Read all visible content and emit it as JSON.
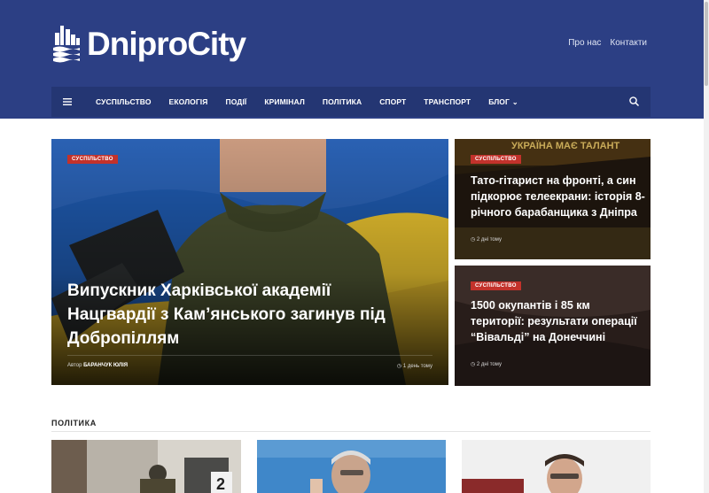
{
  "site": {
    "logo_text": "DniproCity",
    "top_links": [
      "Про нас",
      "Контакти"
    ]
  },
  "nav": {
    "items": [
      "СУСПІЛЬСТВО",
      "ЕКОЛОГІЯ",
      "ПОДІЇ",
      "КРИМІНАЛ",
      "ПОЛІТИКА",
      "СПОРТ",
      "ТРАНСПОРТ",
      "БЛОГ"
    ]
  },
  "hero": {
    "category": "СУСПІЛЬСТВО",
    "title": "Випускник Харківської академії Нацгвардії з Кам’янського загинув під Добропіллям",
    "author_label": "Автор",
    "author": "БАРАНЧУК ЮЛІЯ",
    "time": "1 день тому"
  },
  "side_articles": [
    {
      "category": "СУСПІЛЬСТВО",
      "title": "Тато-гітарист на фронті, а син підкорює телеекрани: історія 8-річного барабанщика з Дніпра",
      "time": "2 дні тому",
      "bg_text": "УКРАЇНА МАЄ ТАЛАНТ"
    },
    {
      "category": "СУСПІЛЬСТВО",
      "title": "1500 окупантів і 85 км території: результати операції “Вівальді” на Донеччині",
      "time": "2 дні тому"
    }
  ],
  "section": {
    "label": "ПОЛІТИКА"
  },
  "colors": {
    "header": "#2c3f84",
    "navbar": "#243673",
    "badge": "#c3322b"
  },
  "icons": [
    "city-logo-icon",
    "menu-icon",
    "search-icon",
    "clock-icon",
    "chevron-down-icon"
  ]
}
